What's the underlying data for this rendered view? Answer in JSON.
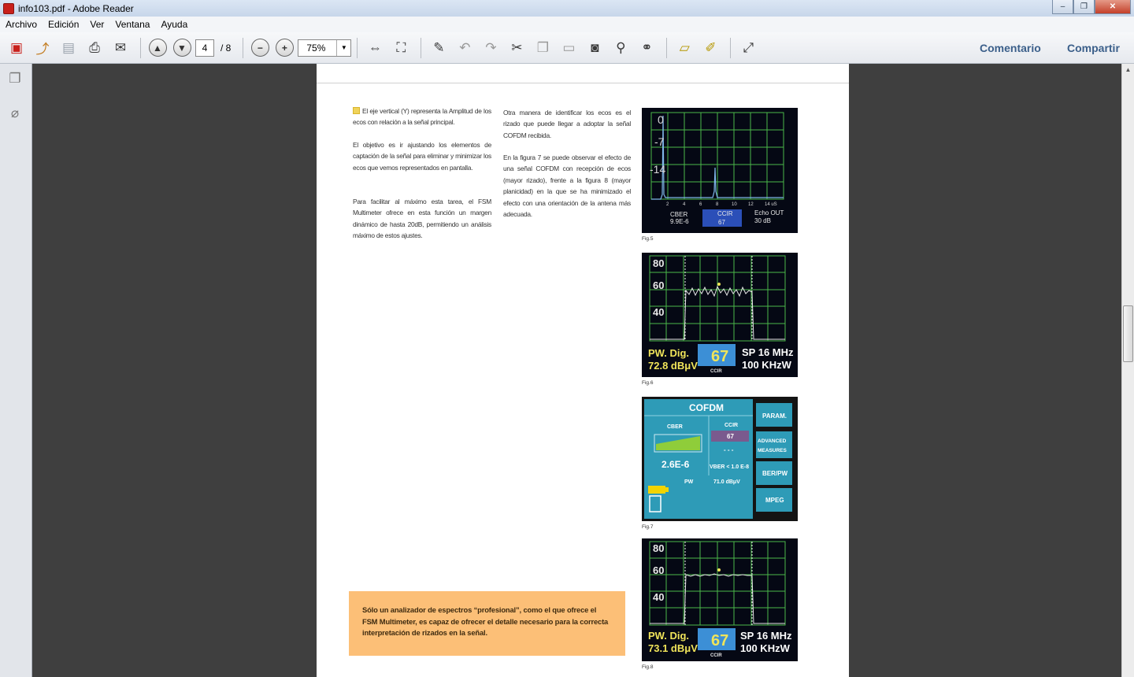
{
  "window": {
    "title": "info103.pdf - Adobe Reader",
    "controls": [
      "–",
      "❐",
      "✕"
    ]
  },
  "menu": [
    "Archivo",
    "Edición",
    "Ver",
    "Ventana",
    "Ayuda"
  ],
  "toolbar": {
    "page_current": "4",
    "page_total": "/ 8",
    "zoom": "75%",
    "comment": "Comentario",
    "share": "Compartir"
  },
  "content": {
    "col1": [
      "El eje vertical (Y) representa la Amplitud de los ecos con relación a la señal principal.",
      "El objetivo es ir ajustando los elementos de captación de la señal para eliminar y minimizar los ecos que vemos representados en pantalla.",
      "Para facilitar al máximo esta tarea, el FSM Multimeter ofrece en esta función un margen dinámico de hasta 20dB, permitiendo un análisis máximo de estos ajustes."
    ],
    "col2": [
      "Otra manera de identificar los ecos es el rizado que puede llegar a adoptar la señal COFDM recibida.",
      "En la figura 7 se puede observar el efecto de una señal COFDM con recepción de ecos (mayor rizado), frente a la figura 8 (mayor planicidad) en la que se ha minimizado el efecto con una orientación de la antena más adecuada."
    ],
    "callout": "Sólo un analizador de espectros “profesional”, como el que ofrece el FSM Multimeter, es capaz de ofrecer el detalle necesario para la correcta interpretación de rizados en la señal."
  },
  "figures": {
    "fig5": {
      "caption": "Fig.5",
      "yticks": [
        "0",
        "-7",
        "-14"
      ],
      "xticks": [
        "2",
        "4",
        "6",
        "8",
        "10",
        "12",
        "14 uS"
      ],
      "cber_label": "CBER",
      "cber_value": "9.9E-6",
      "ccir_label": "CCIR",
      "ccir_value": "67",
      "echo_label": "Echo OUT",
      "echo_value": "30 dB"
    },
    "fig6": {
      "caption": "Fig.6",
      "yticks": [
        "80",
        "60",
        "40"
      ],
      "pw_label": "PW. Dig.",
      "pw_value": "72.8 dBμV",
      "ccir_value": "67",
      "ccir_label": "CCIR",
      "sp": "SP 16 MHz",
      "rbw": "100 KHzW"
    },
    "fig7": {
      "caption": "Fig.7",
      "title": "COFDM",
      "cber_label": "CBER",
      "ccir_label": "CCIR",
      "ccir_value": "67",
      "dots": "- - -",
      "cber_value": "2.6E-6",
      "vber": "VBER < 1.0 E-8",
      "pw_label": "PW",
      "pw_value": "71.0 dBμV",
      "buttons": [
        "PARAM.",
        "ADVANCED MEASURES",
        "BER/PW",
        "MPEG"
      ]
    },
    "fig8": {
      "caption": "Fig.8",
      "yticks": [
        "80",
        "60",
        "40"
      ],
      "pw_label": "PW. Dig.",
      "pw_value": "73.1 dBμV",
      "ccir_value": "67",
      "ccir_label": "CCIR",
      "sp": "SP 16 MHz",
      "rbw": "100 KHzW"
    }
  },
  "colors": {
    "grid": "#4ab84a",
    "trace": "#e6e6e6",
    "screen": "#050814",
    "yellow": "#f0e45a",
    "cofdm": "#2e9bb7"
  }
}
